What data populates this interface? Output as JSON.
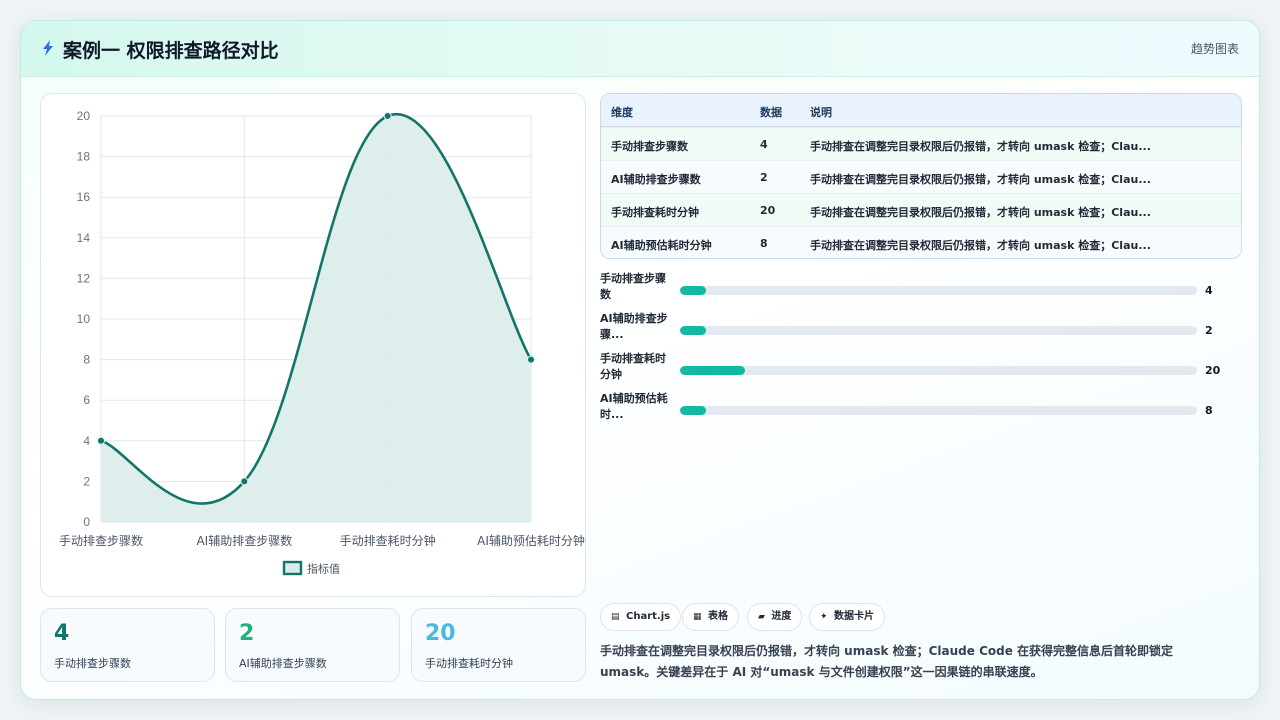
{
  "header": {
    "title": "案例一 权限排查路径对比",
    "tag": "趋势图表"
  },
  "chart_data": {
    "type": "line",
    "categories": [
      "手动排查步骤数",
      "AI辅助排查步骤数",
      "手动排查耗时分钟",
      "AI辅助预估耗时分钟"
    ],
    "series": [
      {
        "name": "指标值",
        "values": [
          4,
          2,
          20,
          8
        ]
      }
    ],
    "ylim": [
      0,
      20
    ],
    "yticks": [
      "0",
      "2",
      "4",
      "6",
      "8",
      "10",
      "12",
      "14",
      "16",
      "18",
      "20"
    ],
    "curve": "smooth",
    "fill": true,
    "grid": true,
    "legend": "bottom",
    "colors": {
      "line": "#12756c",
      "fill": "#d8ebe9",
      "grid": "#dfe7ee"
    }
  },
  "stats": [
    {
      "value": "4",
      "label": "手动排查步骤数",
      "color": "#12756c"
    },
    {
      "value": "2",
      "label": "AI辅助排查步骤数",
      "color": "#22b07d"
    },
    {
      "value": "20",
      "label": "手动排查耗时分钟",
      "color": "#4cb8dd"
    }
  ],
  "table": {
    "headers": [
      "维度",
      "数据",
      "说明"
    ],
    "rows": [
      {
        "dim": "手动排查步骤数",
        "val": "4",
        "desc": "手动排查在调整完目录权限后仍报错，才转向 umask 检查；Clau..."
      },
      {
        "dim": "AI辅助排查步骤数",
        "val": "2",
        "desc": "手动排查在调整完目录权限后仍报错，才转向 umask 检查；Clau..."
      },
      {
        "dim": "手动排查耗时分钟",
        "val": "20",
        "desc": "手动排查在调整完目录权限后仍报错，才转向 umask 检查；Clau..."
      },
      {
        "dim": "AI辅助预估耗时分钟",
        "val": "8",
        "desc": "手动排查在调整完目录权限后仍报错，才转向 umask 检查；Clau..."
      }
    ]
  },
  "progress": {
    "max": 100,
    "items": [
      {
        "label": "手动排查步骤数",
        "value": "4",
        "percent": 5
      },
      {
        "label": "AI辅助排查步骤...",
        "value": "2",
        "percent": 5
      },
      {
        "label": "手动排查耗时分钟",
        "value": "20",
        "percent": 12.5
      },
      {
        "label": "AI辅助预估耗时...",
        "value": "8",
        "percent": 5
      }
    ]
  },
  "chips": [
    {
      "icon": "chart-icon",
      "glyph": "▤",
      "label": "Chart.js"
    },
    {
      "icon": "table-icon",
      "glyph": "▦",
      "label": "表格"
    },
    {
      "icon": "progress-icon",
      "glyph": "▰",
      "label": "进度"
    },
    {
      "icon": "sparkle-icon",
      "glyph": "✦",
      "label": "数据卡片"
    }
  ],
  "summary": "手动排查在调整完目录权限后仍报错，才转向 umask 检查；Claude Code 在获得完整信息后首轮即锁定 umask。关键差异在于 AI 对“umask 与文件创建权限”这一因果链的串联速度。"
}
